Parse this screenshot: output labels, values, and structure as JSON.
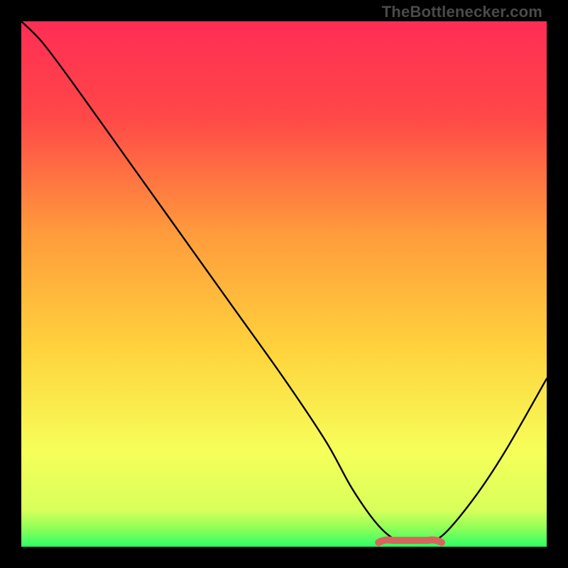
{
  "watermark": "TheBottlenecker.com",
  "colors": {
    "gradient_top": "#ff2d55",
    "gradient_mid_upper": "#ff7a3c",
    "gradient_mid": "#ffd23c",
    "gradient_lower": "#f8ff60",
    "gradient_bottom": "#2eff66",
    "curve": "#000000",
    "marker": "#d9645e",
    "frame": "#000000"
  },
  "chart_data": {
    "type": "line",
    "title": "",
    "xlabel": "",
    "ylabel": "",
    "xlim": [
      0,
      100
    ],
    "ylim": [
      0,
      100
    ],
    "grid": false,
    "legend": false,
    "series": [
      {
        "name": "bottleneck-curve",
        "x": [
          0,
          4,
          10,
          20,
          30,
          40,
          50,
          58,
          63,
          68,
          72,
          76,
          80,
          86,
          92,
          100
        ],
        "y": [
          100,
          96,
          88,
          74,
          60,
          46,
          32,
          20,
          11,
          4,
          1,
          1,
          2,
          9,
          18,
          32
        ]
      }
    ],
    "optimal_range": {
      "x_start": 68,
      "x_end": 80,
      "y": 1.2
    },
    "annotations": []
  }
}
